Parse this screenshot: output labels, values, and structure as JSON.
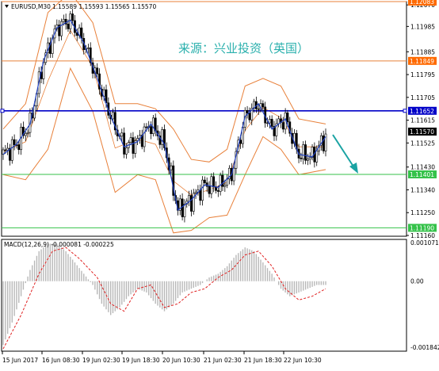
{
  "header": {
    "symbol_label": "EURUSD,M30",
    "ohlc": "1.15589 1.15593 1.15565 1.15570"
  },
  "watermark": "来源：兴业投资（英国）",
  "macd": {
    "label": "MACD(12,26,9) -0.000081 -0.000225"
  },
  "colors": {
    "background": "#ffffff",
    "candle": "#000000",
    "ma": "#1f3fbf",
    "bollinger": "#e8803a",
    "resistance": "#e8803a",
    "resistance_tag": "#ff6a00",
    "pivot": "#0000c8",
    "support": "#35c24a",
    "price_tag": "#000000",
    "arrow": "#1aa3a3",
    "macd_hist": "#b8b8b8",
    "macd_signal": "#e02020"
  },
  "chart_data": [
    {
      "type": "candlestick",
      "symbol": "EURUSD",
      "timeframe": "M30",
      "last": 1.1557,
      "ylim": [
        1.1116,
        1.1208
      ],
      "y_ticks": [
        "1.12070",
        "1.11985",
        "1.11885",
        "1.11795",
        "1.11705",
        "1.11615",
        "1.11525",
        "1.11430",
        "1.11340",
        "1.11250",
        "1.11160"
      ],
      "x_ticks": [
        "15 Jun 2017",
        "16 Jun 08:30",
        "19 Jun 02:30",
        "19 Jun 18:30",
        "20 Jun 10:30",
        "21 Jun 02:30",
        "21 Jun 18:30",
        "22 Jun 10:30"
      ],
      "levels": [
        {
          "value": "1.12083",
          "kind": "resistance"
        },
        {
          "value": "1.11849",
          "kind": "resistance"
        },
        {
          "value": "1.11652",
          "kind": "pivot"
        },
        {
          "value": "1.11570",
          "kind": "last"
        },
        {
          "value": "1.11401",
          "kind": "support"
        },
        {
          "value": "1.11190",
          "kind": "support"
        }
      ],
      "price_path": [
        [
          0,
          1.1148
        ],
        [
          6,
          1.1152
        ],
        [
          12,
          1.116
        ],
        [
          18,
          1.1185
        ],
        [
          24,
          1.1198
        ],
        [
          30,
          1.1201
        ],
        [
          36,
          1.1192
        ],
        [
          42,
          1.1178
        ],
        [
          48,
          1.1163
        ],
        [
          54,
          1.1151
        ],
        [
          60,
          1.1153
        ],
        [
          66,
          1.116
        ],
        [
          72,
          1.1152
        ],
        [
          78,
          1.1126
        ],
        [
          84,
          1.113
        ],
        [
          90,
          1.1136
        ],
        [
          96,
          1.1135
        ],
        [
          102,
          1.114
        ],
        [
          108,
          1.1163
        ],
        [
          114,
          1.1168
        ],
        [
          120,
          1.1158
        ],
        [
          126,
          1.1162
        ],
        [
          132,
          1.1148
        ],
        [
          138,
          1.1147
        ],
        [
          144,
          1.1155
        ]
      ],
      "bollinger_upper": [
        [
          0,
          1.1158
        ],
        [
          10,
          1.1168
        ],
        [
          20,
          1.1204
        ],
        [
          30,
          1.1212
        ],
        [
          40,
          1.12
        ],
        [
          50,
          1.1168
        ],
        [
          60,
          1.1168
        ],
        [
          68,
          1.1166
        ],
        [
          76,
          1.1158
        ],
        [
          84,
          1.1146
        ],
        [
          92,
          1.1145
        ],
        [
          100,
          1.115
        ],
        [
          108,
          1.1175
        ],
        [
          116,
          1.1178
        ],
        [
          124,
          1.1175
        ],
        [
          132,
          1.1162
        ],
        [
          144,
          1.116
        ]
      ],
      "bollinger_lower": [
        [
          0,
          1.114
        ],
        [
          10,
          1.1138
        ],
        [
          20,
          1.115
        ],
        [
          30,
          1.1182
        ],
        [
          40,
          1.1165
        ],
        [
          50,
          1.1133
        ],
        [
          60,
          1.114
        ],
        [
          68,
          1.1138
        ],
        [
          76,
          1.1117
        ],
        [
          84,
          1.1118
        ],
        [
          92,
          1.1123
        ],
        [
          100,
          1.1124
        ],
        [
          108,
          1.114
        ],
        [
          116,
          1.1155
        ],
        [
          124,
          1.115
        ],
        [
          132,
          1.114
        ],
        [
          144,
          1.1142
        ]
      ],
      "forecast_arrow": {
        "direction": "down"
      }
    },
    {
      "type": "macd",
      "params": [
        12,
        26,
        9
      ],
      "macd_value": -8.1e-05,
      "signal_value": -0.000225,
      "y_ticks": [
        "0.001071",
        "0.00",
        "-0.001842"
      ],
      "ylim": [
        -0.001842,
        0.001071
      ],
      "histogram": [
        [
          0,
          -0.0017
        ],
        [
          4,
          -0.0011
        ],
        [
          8,
          -0.0004
        ],
        [
          12,
          0.0003
        ],
        [
          16,
          0.0008
        ],
        [
          20,
          0.001
        ],
        [
          24,
          0.001
        ],
        [
          28,
          0.0008
        ],
        [
          32,
          0.0005
        ],
        [
          36,
          0.0002
        ],
        [
          40,
          -0.0001
        ],
        [
          44,
          -0.0006
        ],
        [
          48,
          -0.0009
        ],
        [
          52,
          -0.0007
        ],
        [
          56,
          -0.0004
        ],
        [
          60,
          -0.0002
        ],
        [
          64,
          -0.0003
        ],
        [
          68,
          -0.0006
        ],
        [
          72,
          -0.0008
        ],
        [
          76,
          -0.0006
        ],
        [
          80,
          -0.0003
        ],
        [
          84,
          -0.0002
        ],
        [
          88,
          -0.0001
        ],
        [
          92,
          0.0001
        ],
        [
          96,
          0.0002
        ],
        [
          100,
          0.0004
        ],
        [
          104,
          0.0007
        ],
        [
          108,
          0.0009
        ],
        [
          112,
          0.0008
        ],
        [
          116,
          0.0005
        ],
        [
          120,
          0.0002
        ],
        [
          124,
          -0.0002
        ],
        [
          128,
          -0.0004
        ],
        [
          132,
          -0.0003
        ],
        [
          136,
          -0.0002
        ],
        [
          140,
          -0.0001
        ],
        [
          144,
          -0.0001
        ]
      ],
      "signal_path": [
        [
          0,
          -0.0018
        ],
        [
          8,
          -0.0009
        ],
        [
          16,
          0.0002
        ],
        [
          22,
          0.0008
        ],
        [
          28,
          0.0009
        ],
        [
          34,
          0.0006
        ],
        [
          42,
          0.0001
        ],
        [
          48,
          -0.0006
        ],
        [
          54,
          -0.0008
        ],
        [
          60,
          -0.0002
        ],
        [
          66,
          -0.0001
        ],
        [
          72,
          -0.0007
        ],
        [
          78,
          -0.0006
        ],
        [
          84,
          -0.0003
        ],
        [
          90,
          -0.0002
        ],
        [
          96,
          0.0001
        ],
        [
          102,
          0.0003
        ],
        [
          108,
          0.0007
        ],
        [
          114,
          0.0008
        ],
        [
          120,
          0.0004
        ],
        [
          126,
          -0.0002
        ],
        [
          132,
          -0.0005
        ],
        [
          138,
          -0.0004
        ],
        [
          144,
          -0.0002
        ]
      ]
    }
  ]
}
